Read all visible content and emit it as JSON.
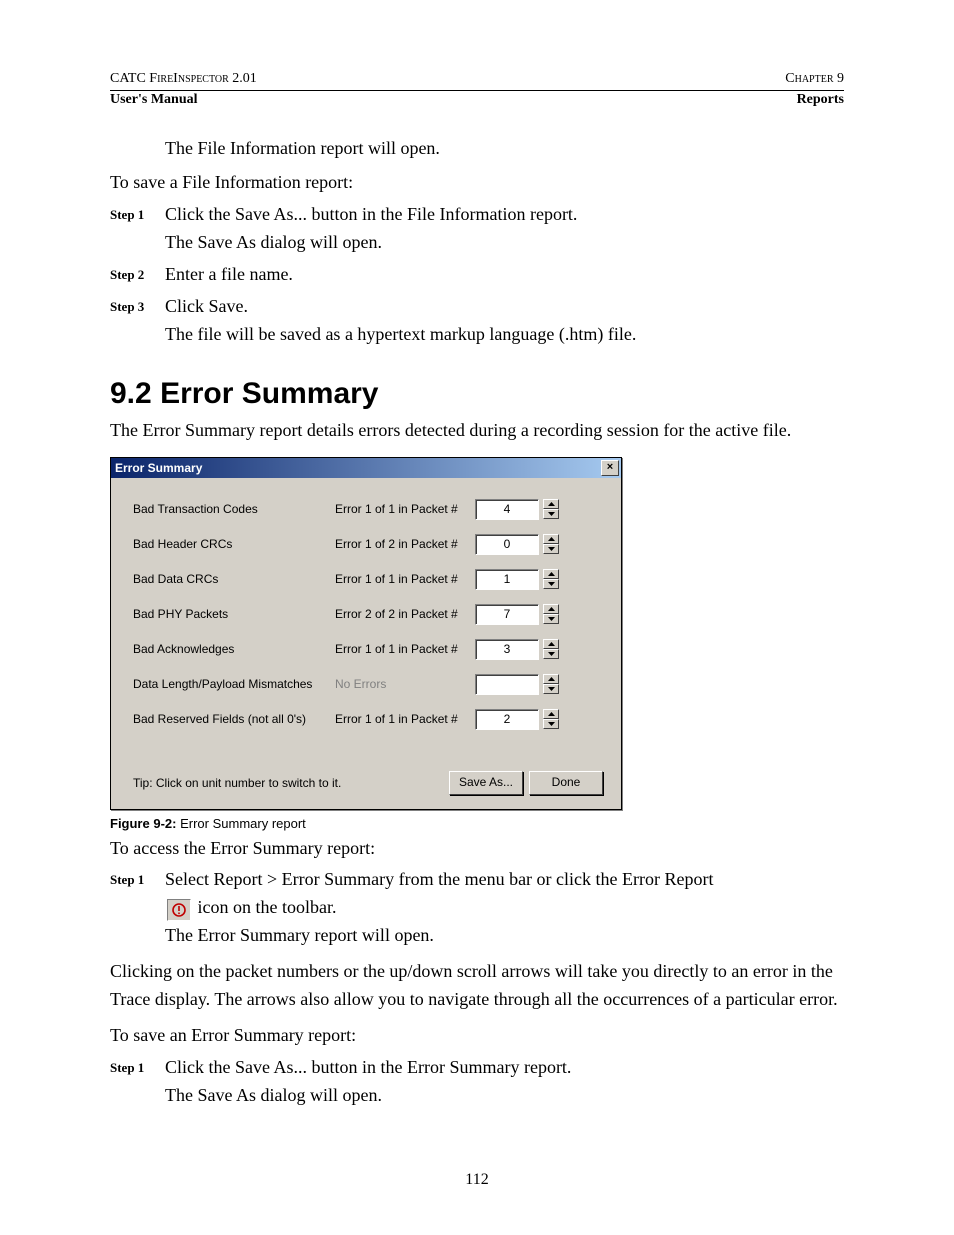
{
  "header": {
    "top_left": "CATC FireInspector 2.01",
    "top_right": "Chapter 9",
    "bottom_left": "User's Manual",
    "bottom_right": "Reports"
  },
  "intro": {
    "line1": "The File Information report will open.",
    "line2": "To save a File Information report:",
    "steps": [
      {
        "label": "Step 1",
        "text1": "Click the Save As... button in the File Information report.",
        "text2": "The Save As dialog will open."
      },
      {
        "label": "Step 2",
        "text1": "Enter a file name."
      },
      {
        "label": "Step 3",
        "text1": "Click Save.",
        "text2": "The file will be saved as a hypertext markup language (.htm) file."
      }
    ]
  },
  "section": {
    "number": "9.2",
    "title": "Error Summary",
    "para": "The Error Summary report details errors detected during a recording session for the active file."
  },
  "dialog": {
    "title": "Error Summary",
    "rows": [
      {
        "name": "Bad Transaction Codes",
        "status": "Error 1 of 1 in Packet #",
        "value": "4",
        "dim": false
      },
      {
        "name": "Bad Header CRCs",
        "status": "Error 1 of 2 in Packet #",
        "value": "0",
        "dim": false
      },
      {
        "name": "Bad Data CRCs",
        "status": "Error 1 of 1 in Packet #",
        "value": "1",
        "dim": false
      },
      {
        "name": "Bad PHY Packets",
        "status": "Error 2 of 2 in Packet #",
        "value": "7",
        "dim": false
      },
      {
        "name": "Bad Acknowledges",
        "status": "Error 1 of 1 in Packet #",
        "value": "3",
        "dim": false
      },
      {
        "name": "Data Length/Payload Mismatches",
        "status": "No Errors",
        "value": "",
        "dim": true
      },
      {
        "name": "Bad Reserved Fields (not all 0's)",
        "status": "Error 1 of 1 in Packet #",
        "value": "2",
        "dim": false
      }
    ],
    "tip": "Tip: Click on unit number to switch to it.",
    "save_label": "Save As...",
    "done_label": "Done"
  },
  "figure": {
    "label": "Figure 9-2:",
    "text": "Error Summary report"
  },
  "access": {
    "intro": "To access the Error Summary report:",
    "step_label": "Step 1",
    "step_text_a": "Select Report > Error Summary from the menu bar or click the Error Report",
    "step_text_b": "icon on the toolbar.",
    "step_text_c": "The Error Summary report will open."
  },
  "click_para": "Clicking on the packet numbers or the up/down scroll arrows will take you directly to an error in the Trace display. The arrows also allow you to navigate through all the occurrences of a particular error.",
  "save": {
    "intro": "To save an Error Summary report:",
    "step_label": "Step 1",
    "text1": "Click the Save As... button in the Error Summary report.",
    "text2": "The Save As dialog will open."
  },
  "page_number": "112"
}
